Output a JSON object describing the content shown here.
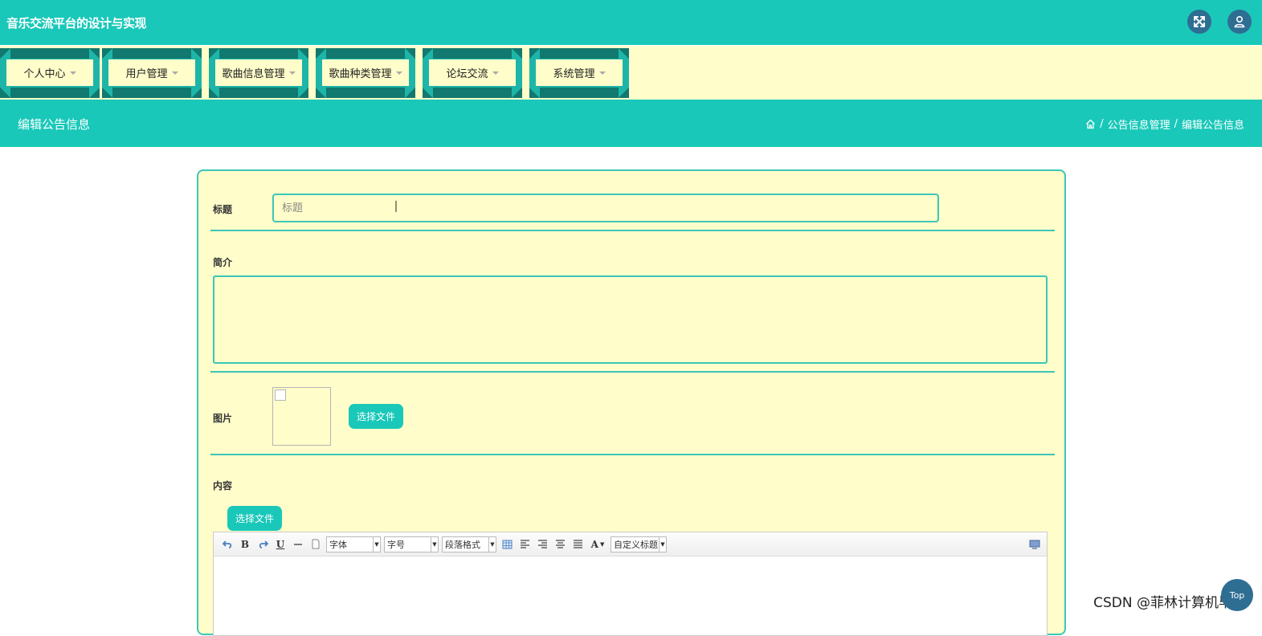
{
  "header": {
    "app_title": "音乐交流平台的设计与实现",
    "fullscreen_icon": "expand-icon",
    "user_icon": "user-icon"
  },
  "nav": {
    "items": [
      {
        "label": "个人中心"
      },
      {
        "label": "用户管理"
      },
      {
        "label": "歌曲信息管理"
      },
      {
        "label": "歌曲种类管理"
      },
      {
        "label": "论坛交流"
      },
      {
        "label": "系统管理"
      }
    ]
  },
  "subheader": {
    "page_title": "编辑公告信息",
    "breadcrumb": {
      "home_icon": "home-icon",
      "separator": "/",
      "level1": "公告信息管理",
      "level2": "编辑公告信息"
    }
  },
  "form": {
    "title_label": "标题",
    "title_placeholder": "标题",
    "title_value": "",
    "intro_label": "简介",
    "intro_value": "",
    "image_label": "图片",
    "image_button": "选择文件",
    "content_label": "内容",
    "content_button": "选择文件",
    "editor": {
      "font_select": "字体",
      "size_select": "字号",
      "paragraph_select": "段落格式",
      "custom_title_select": "自定义标题"
    }
  },
  "footer": {
    "watermark": "CSDN @菲林计算机毕设",
    "top_button": "Top"
  },
  "colors": {
    "primary": "#19c8b9",
    "nav_bg": "#fffdca",
    "nav_edge": "#11796f",
    "circle_btn": "#2e6e93"
  }
}
